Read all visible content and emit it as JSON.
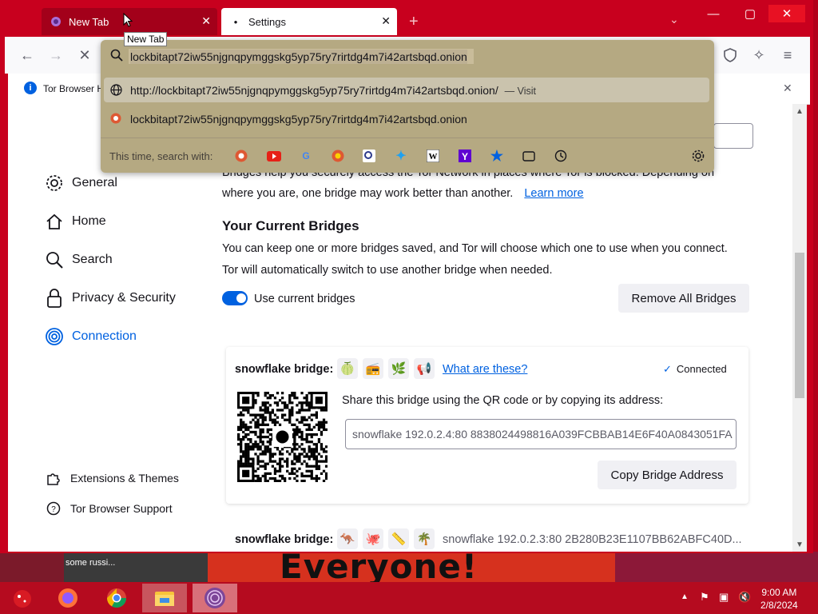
{
  "tabs": [
    {
      "label": "New Tab",
      "active": false
    },
    {
      "label": "Settings",
      "active": true
    }
  ],
  "tooltip": "New Tab",
  "window_controls": {
    "minimize": "—",
    "maximize": "▢",
    "close": "✕"
  },
  "urlbar": {
    "value": "lockbitapt72iw55njgnqpymggskg5yp75ry7rirtdg4m7i42artsbqd.onion",
    "suggestions": [
      {
        "text": "http://lockbitapt72iw55njgnqpymggskg5yp75ry7rirtdg4m7i42artsbqd.onion/",
        "action": "— Visit",
        "icon": "globe-icon"
      },
      {
        "text": "lockbitapt72iw55njgnqpymggskg5yp75ry7rirtdg4m7i42artsbqd.onion",
        "icon": "duckduckgo-icon"
      }
    ],
    "search_with_label": "This time, search with:",
    "engines": [
      "duckduckgo",
      "youtube",
      "google",
      "duckduckgo-html",
      "startpage",
      "twitter",
      "wikipedia",
      "yahoo",
      "bookmarks",
      "tabs",
      "history"
    ]
  },
  "notification": {
    "text": "Tor Browser H"
  },
  "sidebar": {
    "items": [
      {
        "label": "General",
        "icon": "gear-icon"
      },
      {
        "label": "Home",
        "icon": "home-icon"
      },
      {
        "label": "Search",
        "icon": "search-icon"
      },
      {
        "label": "Privacy & Security",
        "icon": "lock-icon"
      },
      {
        "label": "Connection",
        "icon": "connection-icon",
        "active": true
      }
    ],
    "footer": [
      {
        "label": "Extensions & Themes",
        "icon": "puzzle-icon"
      },
      {
        "label": "Tor Browser Support",
        "icon": "help-icon"
      }
    ]
  },
  "main": {
    "partial_text": "Bridges help you securely access the Tor Network in places where Tor is blocked. Depending on",
    "intro_line2": "where you are, one bridge may work better than another.",
    "learn_more": "Learn more",
    "current_bridges_title": "Your Current Bridges",
    "current_bridges_desc1": "You can keep one or more bridges saved, and Tor will choose which one to use when you connect.",
    "current_bridges_desc2": "Tor will automatically switch to use another bridge when needed.",
    "use_current_bridges": "Use current bridges",
    "use_current_bridges_on": true,
    "remove_all": "Remove All Bridges"
  },
  "bridge_card": {
    "label": "snowflake bridge:",
    "emojis": [
      "🍈",
      "📻",
      "🌿",
      "📢"
    ],
    "what_are_these": "What are these?",
    "status": "Connected",
    "share_text": "Share this bridge using the QR code or by copying its address:",
    "address": "snowflake 192.0.2.4:80 8838024498816A039FCBBAB14E6F40A0843051FA",
    "copy_button": "Copy Bridge Address"
  },
  "bridge2": {
    "label": "snowflake bridge:",
    "emojis": [
      "🦘",
      "🐙",
      "📏",
      "🌴"
    ],
    "address": "snowflake 192.0.2.3:80 2B280B23E1107BB62ABFC40D..."
  },
  "desktop": {
    "caption": "some russi...",
    "banner": "Everyone!"
  },
  "taskbar": {
    "apps": [
      "red-ornament-icon",
      "firefox-icon",
      "chrome-icon",
      "file-explorer-icon",
      "tor-browser-icon"
    ],
    "time": "9:00 AM",
    "date": "2/8/2024"
  },
  "colors": {
    "frame": "#c8001e",
    "accent": "#0061e0",
    "urlpanel": "#b5a982"
  }
}
